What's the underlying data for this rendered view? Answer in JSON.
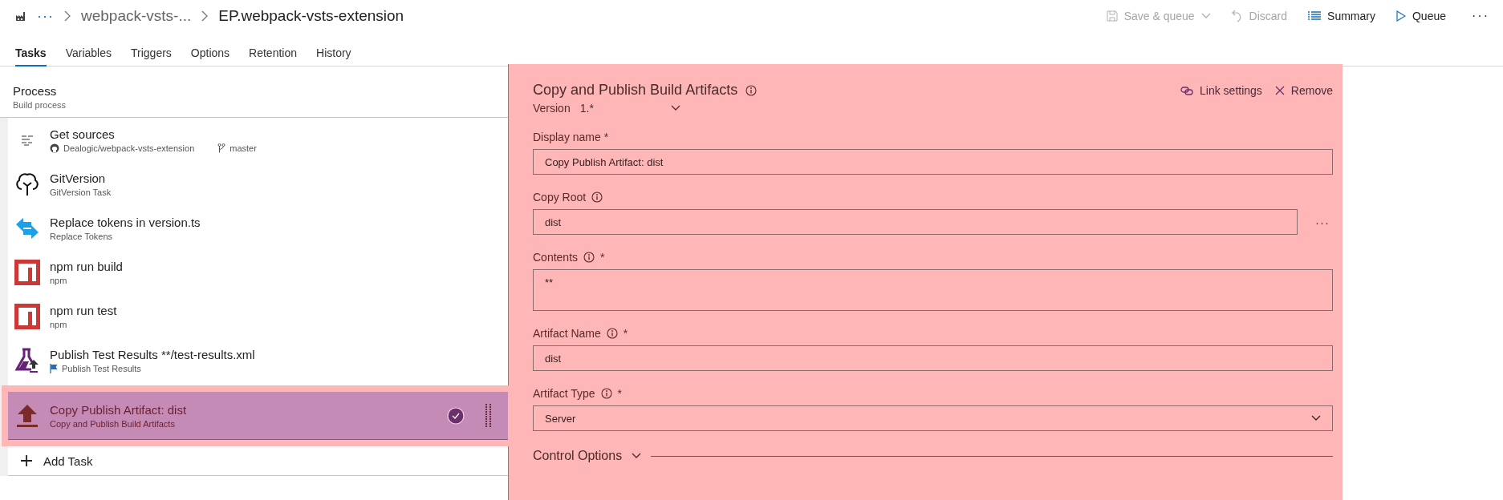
{
  "breadcrumb": {
    "more": "···",
    "project": "webpack-vsts-...",
    "definition": "EP.webpack-vsts-extension"
  },
  "toolbar": [
    {
      "kind": "save",
      "label": "Save & queue",
      "disabled": true
    },
    {
      "kind": "discard",
      "label": "Discard",
      "disabled": true
    },
    {
      "kind": "summary",
      "label": "Summary",
      "disabled": false
    },
    {
      "kind": "queue",
      "label": "Queue",
      "disabled": false
    }
  ],
  "more_button": "···",
  "tabs": [
    {
      "label": "Tasks",
      "selected": true
    },
    {
      "label": "Variables",
      "selected": false
    },
    {
      "label": "Triggers",
      "selected": false
    },
    {
      "label": "Options",
      "selected": false
    },
    {
      "label": "Retention",
      "selected": false
    },
    {
      "label": "History",
      "selected": false
    }
  ],
  "process": {
    "title": "Process",
    "subtitle": "Build process"
  },
  "tasks": [
    {
      "kind": "sources",
      "title": "Get sources",
      "repo": "Dealogic/webpack-vsts-extension",
      "branch": "master",
      "selected": false
    },
    {
      "kind": "gitversion",
      "title": "GitVersion",
      "subtitle": "GitVersion Task",
      "flag": false,
      "selected": false
    },
    {
      "kind": "replace",
      "title": "Replace tokens in version.ts",
      "subtitle": "Replace Tokens",
      "flag": false,
      "selected": false
    },
    {
      "kind": "npm",
      "title": "npm run build",
      "subtitle": "npm",
      "flag": false,
      "selected": false
    },
    {
      "kind": "npm",
      "title": "npm run test",
      "subtitle": "npm",
      "flag": false,
      "selected": false
    },
    {
      "kind": "test",
      "title": "Publish Test Results **/test-results.xml",
      "subtitle": "Publish Test Results",
      "flag": true,
      "selected": false
    },
    {
      "kind": "publish",
      "title": "Copy Publish Artifact: dist",
      "subtitle": "Copy and Publish Build Artifacts",
      "flag": false,
      "selected": true
    }
  ],
  "add_task": "Add Task",
  "panel": {
    "title": "Copy and Publish Build Artifacts",
    "link_settings": "Link settings",
    "remove": "Remove",
    "version_label": "Version",
    "version": "1.*",
    "fields": [
      {
        "kind": "text",
        "label": "Display name *",
        "info": false,
        "value": "Copy Publish Artifact: dist"
      },
      {
        "kind": "browse",
        "label": "Copy Root",
        "info": true,
        "value": "dist",
        "browse": "···"
      },
      {
        "kind": "multiline",
        "label": "Contents",
        "info": true,
        "mark": "*",
        "value": "**"
      },
      {
        "kind": "text",
        "label": "Artifact Name",
        "info": true,
        "mark": "*",
        "value": "dist"
      },
      {
        "kind": "dropdown",
        "label": "Artifact Type",
        "info": true,
        "mark": "*",
        "value": "Server"
      }
    ],
    "control_options": "Control Options"
  }
}
